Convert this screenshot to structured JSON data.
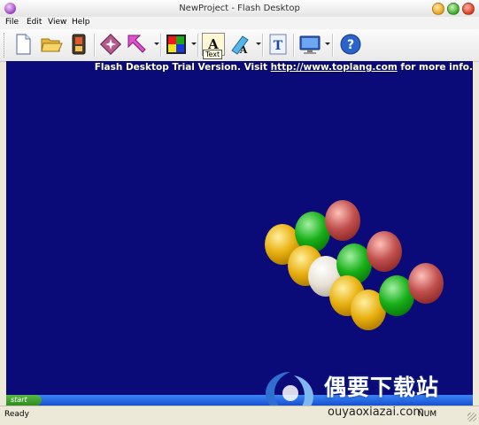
{
  "window": {
    "title": "NewProject - Flash Desktop"
  },
  "menu": [
    "File",
    "Edit",
    "View",
    "Help"
  ],
  "toolbar": {
    "icons": [
      "new-file-icon",
      "open-folder-icon",
      "save-device-icon",
      "effects-icon",
      "arrow-tool-icon",
      "color-palette-icon",
      "text-tool-icon",
      "font-color-icon",
      "text-frame-icon",
      "preview-monitor-icon",
      "help-icon"
    ],
    "tooltip": "Text"
  },
  "stage": {
    "notice_prefix": "Flash Desktop Trial Version. Visit ",
    "notice_link": "http://www.toplang.com",
    "notice_suffix": " for more info.",
    "background": "#0a0a78"
  },
  "taskbar": {
    "start_label": "start"
  },
  "status": {
    "text": "Ready",
    "right_text": "NUM"
  },
  "watermark": {
    "title": "偶要下载站",
    "url": "ouyaoxiazai.com"
  }
}
